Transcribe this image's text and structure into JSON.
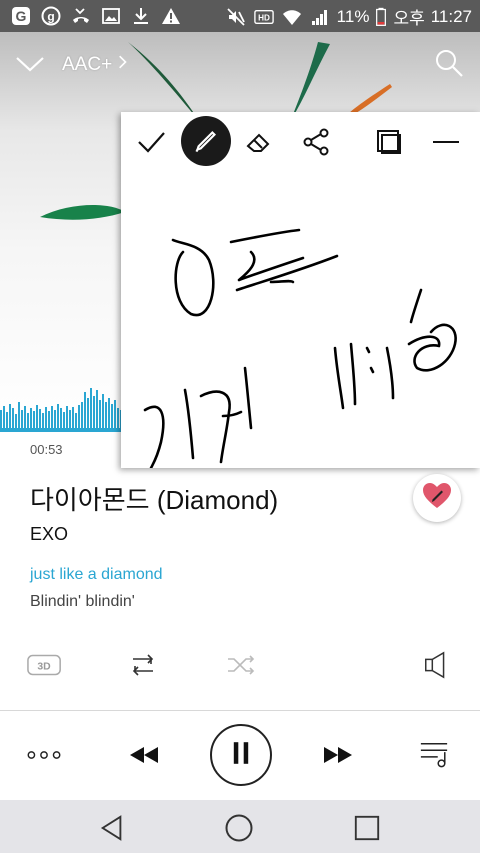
{
  "status_bar": {
    "battery_percent": "11%",
    "period": "오후",
    "time": "11:27",
    "icons": [
      "g-app-icon",
      "glide-icon",
      "missed-call-icon",
      "gallery-icon",
      "download-icon",
      "warning-icon",
      "mute-icon",
      "hd-icon",
      "wifi-icon",
      "signal-icon",
      "battery-icon"
    ]
  },
  "header": {
    "codec": "AAC+"
  },
  "memo": {
    "tools": [
      "confirm-check",
      "pen",
      "eraser",
      "share",
      "capture-layers",
      "minimize"
    ],
    "handwriting_note": ""
  },
  "player": {
    "elapsed": "00:53",
    "title": "다이아몬드 (Diamond)",
    "artist": "EXO",
    "lyric_current": "just like a diamond",
    "lyric_next": "Blindin' blindin'",
    "effect_3d_label": "3D",
    "accent": "#2aa6d2",
    "heart_color": "#e0566b"
  }
}
